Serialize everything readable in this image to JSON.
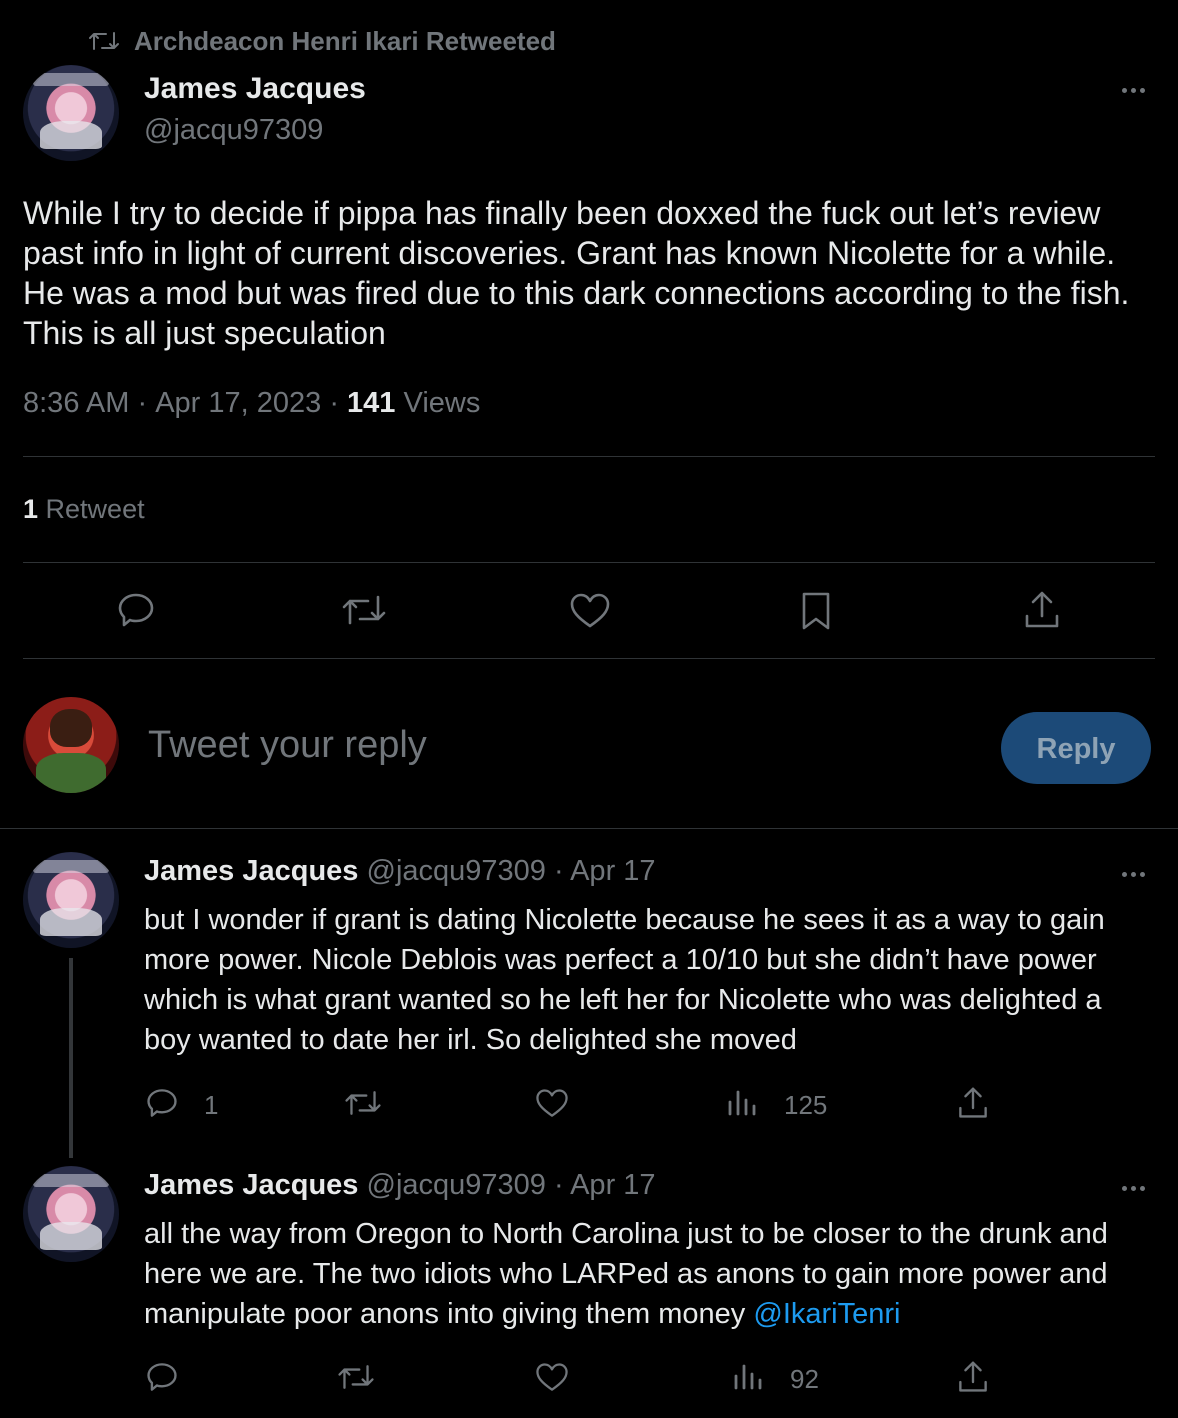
{
  "social_context": {
    "text": "Archdeacon Henri Ikari Retweeted"
  },
  "main_tweet": {
    "author_name": "James Jacques",
    "author_handle": "@jacqu97309",
    "text": "While I try to decide if pippa has finally been doxxed the fuck out let’s review past info in light of current discoveries. Grant has known Nicolette for a while. He was a mod but was fired due to this dark connections according to the fish. This is all just speculation",
    "time": "8:36 AM",
    "separator": " · ",
    "date": "Apr 17, 2023",
    "views_count": "141",
    "views_label": " Views",
    "retweets_count": "1",
    "retweets_label": " Retweet"
  },
  "composer": {
    "placeholder": "Tweet your reply",
    "reply_button": "Reply"
  },
  "thread": [
    {
      "author_name": "James Jacques",
      "author_handle": "@jacqu97309",
      "date": " · Apr 17",
      "text": "but I wonder if grant is dating Nicolette because he sees it as a way to gain more power. Nicole Deblois was perfect a 10/10 but she didn’t have power which is what grant wanted so he left her for Nicolette who was delighted a boy wanted to date her irl. So delighted she moved",
      "reply_count": "1",
      "views": "125"
    },
    {
      "author_name": "James Jacques",
      "author_handle": "@jacqu97309",
      "date": " · Apr 17",
      "text": "all the way from Oregon to North Carolina just to be closer to the drunk and here we are. The two idiots who LARPed as anons to gain more power and manipulate poor anons into giving them money ",
      "mention": "@IkariTenri",
      "views": "92"
    }
  ],
  "colors": {
    "background": "#000000",
    "text_primary": "#e7e9ea",
    "text_secondary": "#71767b",
    "link": "#1d9bf0",
    "divider": "#2f3336",
    "reply_button_bg": "#1c4a78"
  },
  "icons": [
    "retweet-icon",
    "more-icon",
    "reply-icon",
    "like-icon",
    "bookmark-icon",
    "share-icon",
    "views-icon"
  ]
}
